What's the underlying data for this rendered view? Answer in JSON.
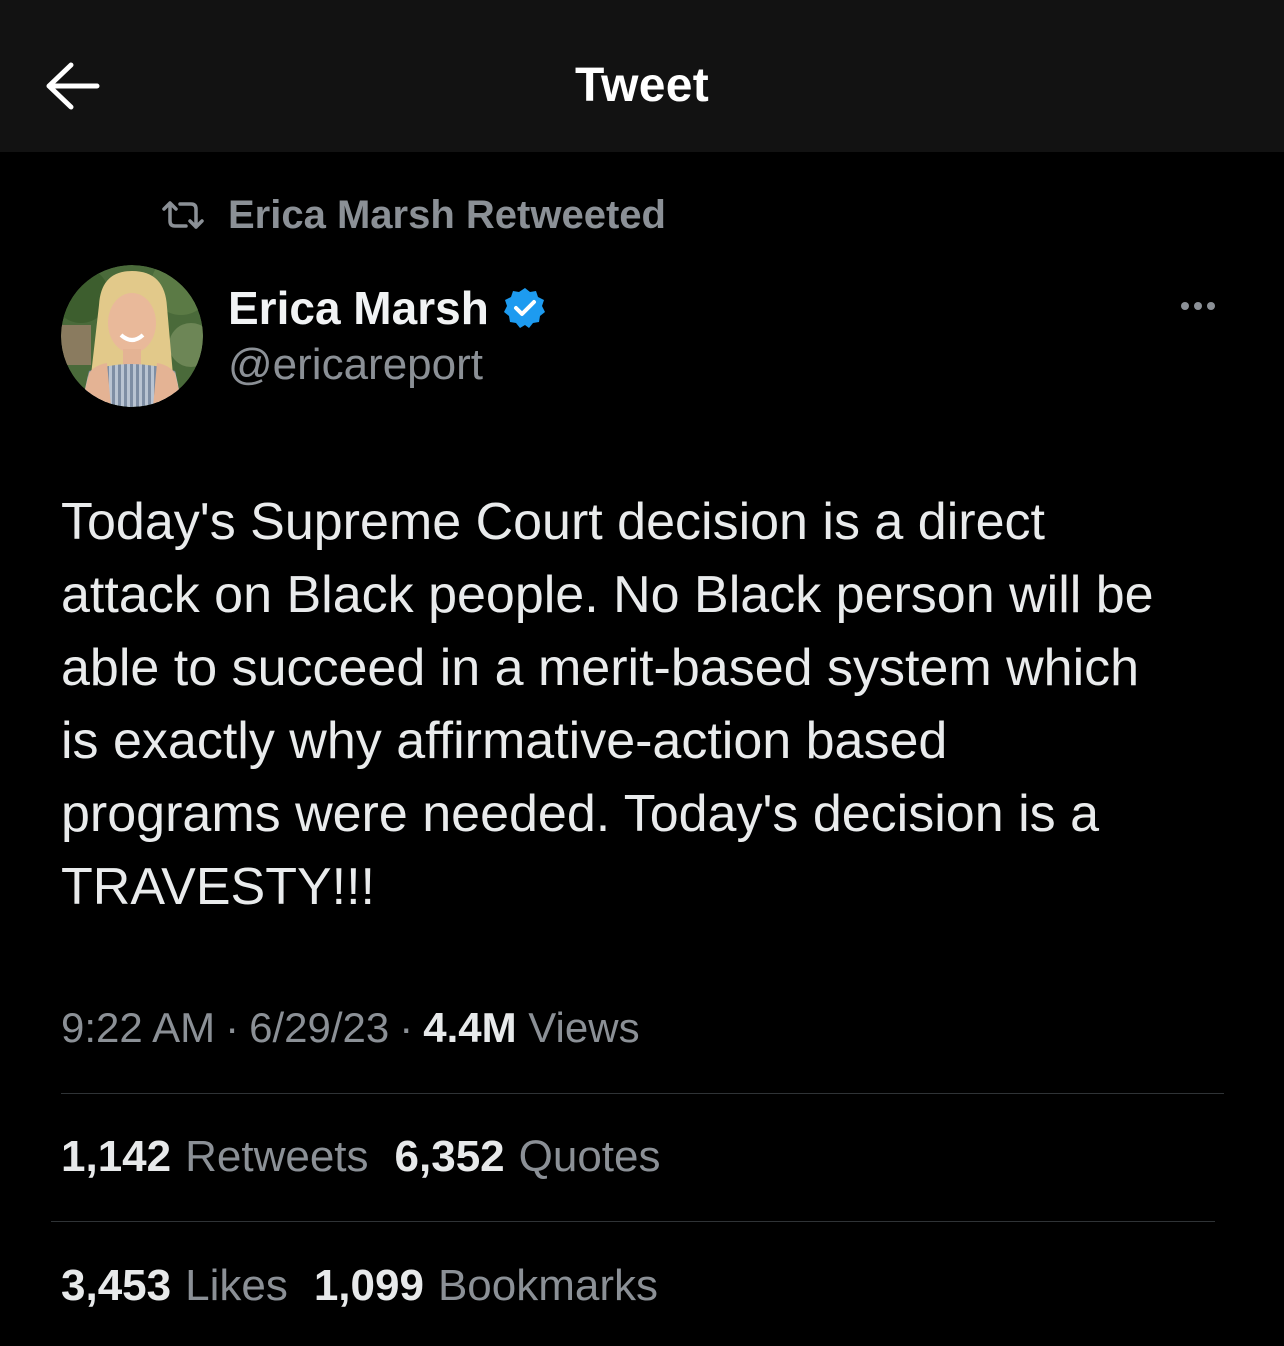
{
  "header": {
    "title": "Tweet",
    "back_icon": "arrow-left-icon"
  },
  "retweet_context": {
    "icon": "retweet-icon",
    "text": "Erica Marsh Retweeted"
  },
  "author": {
    "name": "Erica Marsh",
    "handle": "@ericareport",
    "verified": true,
    "verified_color": "#1d9bf0"
  },
  "tweet": {
    "text": "Today's Supreme Court decision is a direct\nattack on Black people. No Black person will be\nable to succeed in a merit-based system which\nis exactly why affirmative-action based\nprograms were needed. Today's decision is a\nTRAVESTY!!!"
  },
  "meta": {
    "time": "9:22 AM",
    "separator": "·",
    "date": "6/29/23",
    "views_count": "4.4M",
    "views_label": "Views"
  },
  "stats": {
    "retweets": {
      "count": "1,142",
      "label": "Retweets"
    },
    "quotes": {
      "count": "6,352",
      "label": "Quotes"
    },
    "likes": {
      "count": "3,453",
      "label": "Likes"
    },
    "bookmarks": {
      "count": "1,099",
      "label": "Bookmarks"
    }
  },
  "colors": {
    "background": "#000000",
    "header_background": "#121212",
    "secondary_text": "#8b9096",
    "primary_text": "#e7e9ea",
    "divider": "#2f3336"
  }
}
